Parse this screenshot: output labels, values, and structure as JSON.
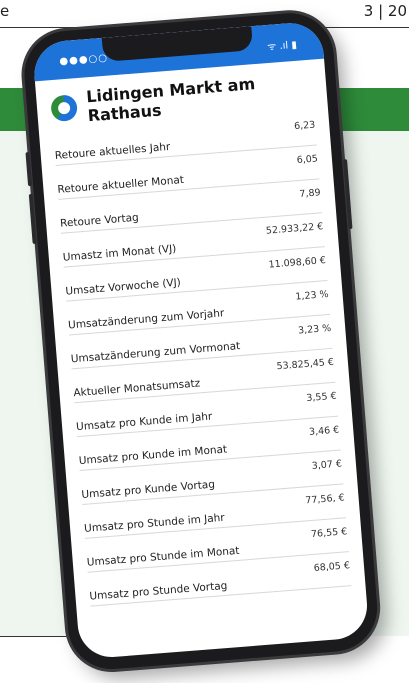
{
  "page": {
    "header_left": "e",
    "header_right": "3 | 20"
  },
  "status": {
    "carrier": "●●●○○",
    "icons": "ᯤ .ıl ▮"
  },
  "app": {
    "title": "Lidingen Markt am Rathaus"
  },
  "kpis": [
    {
      "label": "Retoure aktuelles Jahr",
      "value": "6,23"
    },
    {
      "label": "Retoure aktueller Monat",
      "value": "6,05"
    },
    {
      "label": "Retoure Vortag",
      "value": "7,89"
    },
    {
      "label": "Umastz im Monat (VJ)",
      "value": "52.933,22 €"
    },
    {
      "label": "Umsatz Vorwoche (VJ)",
      "value": "11.098,60 €"
    },
    {
      "label": "Umsatzänderung zum Vorjahr",
      "value": "1,23 %"
    },
    {
      "label": "Umsatzänderung zum Vormonat",
      "value": "3,23 %"
    },
    {
      "label": "Aktueller Monatsumsatz",
      "value": "53.825,45 €"
    },
    {
      "label": "Umsatz pro Kunde im Jahr",
      "value": "3,55 €"
    },
    {
      "label": "Umsatz pro Kunde im Monat",
      "value": "3,46 €"
    },
    {
      "label": "Umsatz pro Kunde Vortag",
      "value": "3,07 €"
    },
    {
      "label": "Umsatz pro Stunde im Jahr",
      "value": "77,56, €"
    },
    {
      "label": "Umsatz pro Stunde im Monat",
      "value": "76,55 €"
    },
    {
      "label": "Umsatz pro Stunde Vortag",
      "value": "68,05 €"
    }
  ],
  "colors": {
    "brand_green": "#2e8b3a",
    "brand_blue": "#1e73d8",
    "panel_mint": "#eef6ef"
  }
}
